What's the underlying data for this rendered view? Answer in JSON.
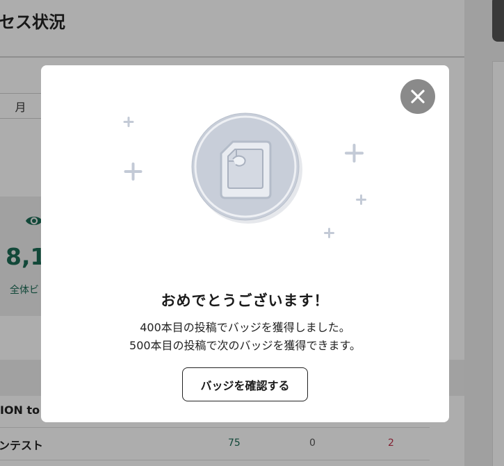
{
  "page": {
    "title": "セス状況",
    "period_tab": "月",
    "stat": {
      "icon": "eye-icon",
      "value": "8,1",
      "label": "全体ビ"
    },
    "rows": [
      {
        "label": "ION to"
      },
      {
        "label": "ンテスト",
        "views": "75",
        "zero": "0",
        "count": "2"
      }
    ]
  },
  "modal": {
    "close_icon": "close-icon",
    "badge_icon": "document-badge-icon",
    "heading": "おめでとうございます！",
    "line1": "400本目の投稿でバッジを獲得しました。",
    "line2": "500本目の投稿で次のバッジを獲得できます。",
    "confirm_label": "バッジを確認する"
  },
  "colors": {
    "accent_green": "#1b6b55",
    "badge_gray": "#c8ced9",
    "overlay": "rgba(0,0,0,0.32)"
  }
}
